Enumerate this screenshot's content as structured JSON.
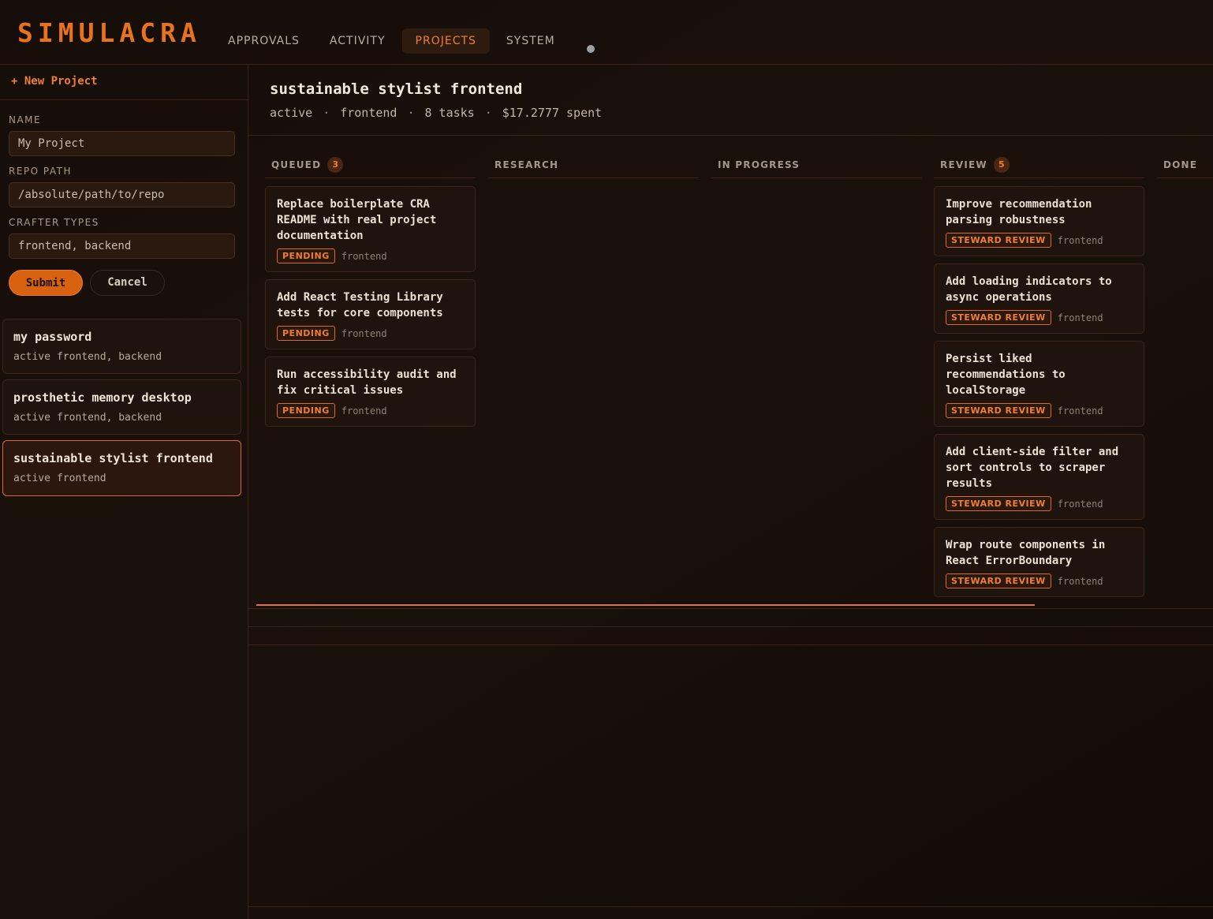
{
  "app": {
    "logo": "SIMULACRA"
  },
  "nav": [
    {
      "label": "APPROVALS",
      "active": false
    },
    {
      "label": "ACTIVITY",
      "active": false
    },
    {
      "label": "PROJECTS",
      "active": true
    },
    {
      "label": "SYSTEM",
      "active": false
    }
  ],
  "sidebar": {
    "new_project": "+ New Project",
    "form": {
      "name_label": "NAME",
      "name_placeholder": "My Project",
      "repo_label": "REPO PATH",
      "repo_placeholder": "/absolute/path/to/repo",
      "crafter_label": "CRAFTER TYPES",
      "crafter_placeholder": "frontend, backend",
      "submit": "Submit",
      "cancel": "Cancel"
    },
    "projects": [
      {
        "name": "my password",
        "status": "active",
        "crafters": "frontend, backend"
      },
      {
        "name": "prosthetic memory desktop",
        "status": "active",
        "crafters": "frontend, backend"
      },
      {
        "name": "sustainable stylist frontend",
        "status": "active",
        "crafters": "frontend"
      }
    ]
  },
  "project": {
    "title": "sustainable stylist frontend",
    "status": "active",
    "crafter": "frontend",
    "tasks": "8 tasks",
    "spent": "$17.2777 spent"
  },
  "board": {
    "columns": [
      {
        "label": "QUEUED",
        "count": "3",
        "tasks": [
          {
            "title": "Replace boilerplate CRA README with real project documentation",
            "badge": "PENDING",
            "crafter": "frontend"
          },
          {
            "title": "Add React Testing Library tests for core components",
            "badge": "PENDING",
            "crafter": "frontend"
          },
          {
            "title": "Run accessibility audit and fix critical issues",
            "badge": "PENDING",
            "crafter": "frontend"
          }
        ]
      },
      {
        "label": "RESEARCH",
        "count": "",
        "tasks": []
      },
      {
        "label": "IN PROGRESS",
        "count": "",
        "tasks": []
      },
      {
        "label": "REVIEW",
        "count": "5",
        "tasks": [
          {
            "title": "Improve recommendation parsing robustness",
            "badge": "STEWARD REVIEW",
            "crafter": "frontend"
          },
          {
            "title": "Add loading indicators to async operations",
            "badge": "STEWARD REVIEW",
            "crafter": "frontend"
          },
          {
            "title": "Persist liked recommendations to localStorage",
            "badge": "STEWARD REVIEW",
            "crafter": "frontend"
          },
          {
            "title": "Add client-side filter and sort controls to scraper results",
            "badge": "STEWARD REVIEW",
            "crafter": "frontend"
          },
          {
            "title": "Wrap route components in React ErrorBoundary",
            "badge": "STEWARD REVIEW",
            "crafter": "frontend"
          }
        ]
      },
      {
        "label": "DONE",
        "count": "",
        "tasks": []
      }
    ]
  }
}
